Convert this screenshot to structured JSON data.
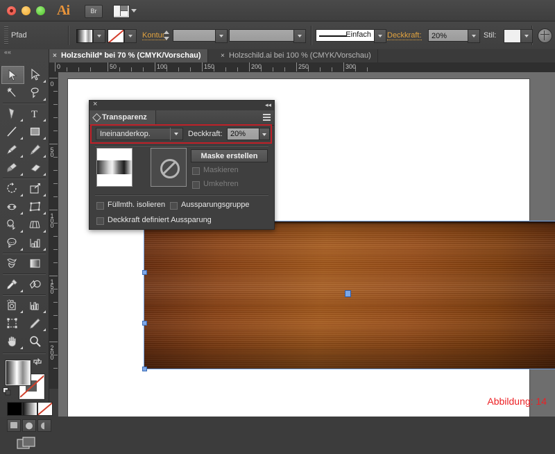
{
  "window": {
    "app_name": "Ai",
    "bridge_button": "Br",
    "buttons": [
      "close",
      "minimize",
      "maximize"
    ]
  },
  "control_bar": {
    "selection_label": "Pfad",
    "stroke_label": "Kontur:",
    "stroke_weight_value": "",
    "stroke_profile_value": "",
    "stroke_style_label": "Einfach",
    "opacity_label": "Deckkraft:",
    "opacity_value": "20%",
    "style_label": "Stil:"
  },
  "tabs": [
    {
      "label": "Holzschild* bei 70 % (CMYK/Vorschau)",
      "active": true,
      "close": "×"
    },
    {
      "label": "Holzschild.ai bei 100 % (CMYK/Vorschau)",
      "active": false,
      "close": "×"
    }
  ],
  "rulers": {
    "horizontal_ticks": [
      "0",
      "50",
      "100",
      "150",
      "200",
      "250",
      "300"
    ],
    "vertical_ticks": [
      "0",
      "50",
      "100",
      "150",
      "200"
    ],
    "units": "mm"
  },
  "tools": {
    "items": [
      "selection-tool",
      "direct-selection-tool",
      "magic-wand-tool",
      "lasso-tool",
      "pen-tool",
      "type-tool",
      "line-segment-tool",
      "rectangle-tool",
      "paintbrush-tool",
      "pencil-tool",
      "blob-brush-tool",
      "eraser-tool",
      "rotate-tool",
      "scale-tool",
      "width-tool",
      "free-transform-tool",
      "shape-builder-tool",
      "perspective-grid-tool",
      "mesh-tool",
      "gradient-tool",
      "eyedropper-tool",
      "blend-tool",
      "symbol-sprayer-tool",
      "column-graph-tool",
      "artboard-tool",
      "slice-tool",
      "hand-tool",
      "zoom-tool"
    ],
    "selected": "selection-tool",
    "fill_swatch": "gradient-fill",
    "stroke_swatch": "none-stroke",
    "color_modes": [
      "color",
      "gradient",
      "none"
    ],
    "screen_modes": [
      "normal-screen-mode",
      "full-screen-with-menu",
      "full-screen"
    ]
  },
  "transparency_panel": {
    "title": "Transparenz",
    "close_glyph": "×",
    "collapse_glyph": "◂◂",
    "blend_mode": "Ineinanderkop.",
    "opacity_label": "Deckkraft:",
    "opacity_value": "20%",
    "make_mask_button": "Maske erstellen",
    "clip_checkbox": "Maskieren",
    "invert_checkbox": "Umkehren",
    "isolate_checkbox": "Füllmth. isolieren",
    "knockout_checkbox": "Aussparungsgruppe",
    "opacity_knockout_checkbox": "Deckkraft definiert Aussparung",
    "highlight_color": "#c02028",
    "thumbnail_art": "gradient-band-thumbnail",
    "thumbnail_mask": "no-mask-thumbnail",
    "checkbox_states": {
      "Maskieren": false,
      "Umkehren": false,
      "Füllmth. isolieren": false,
      "Aussparungsgruppe": false,
      "Deckkraft definiert Aussparung": false
    }
  },
  "canvas": {
    "object": "wood-plank-shape",
    "object_colors": [
      "#6b2f10",
      "#a75b1d",
      "#5e290c"
    ],
    "selection_color": "#7aa7e8",
    "caption": "Abbildung: 14",
    "caption_color": "#ec2024"
  }
}
